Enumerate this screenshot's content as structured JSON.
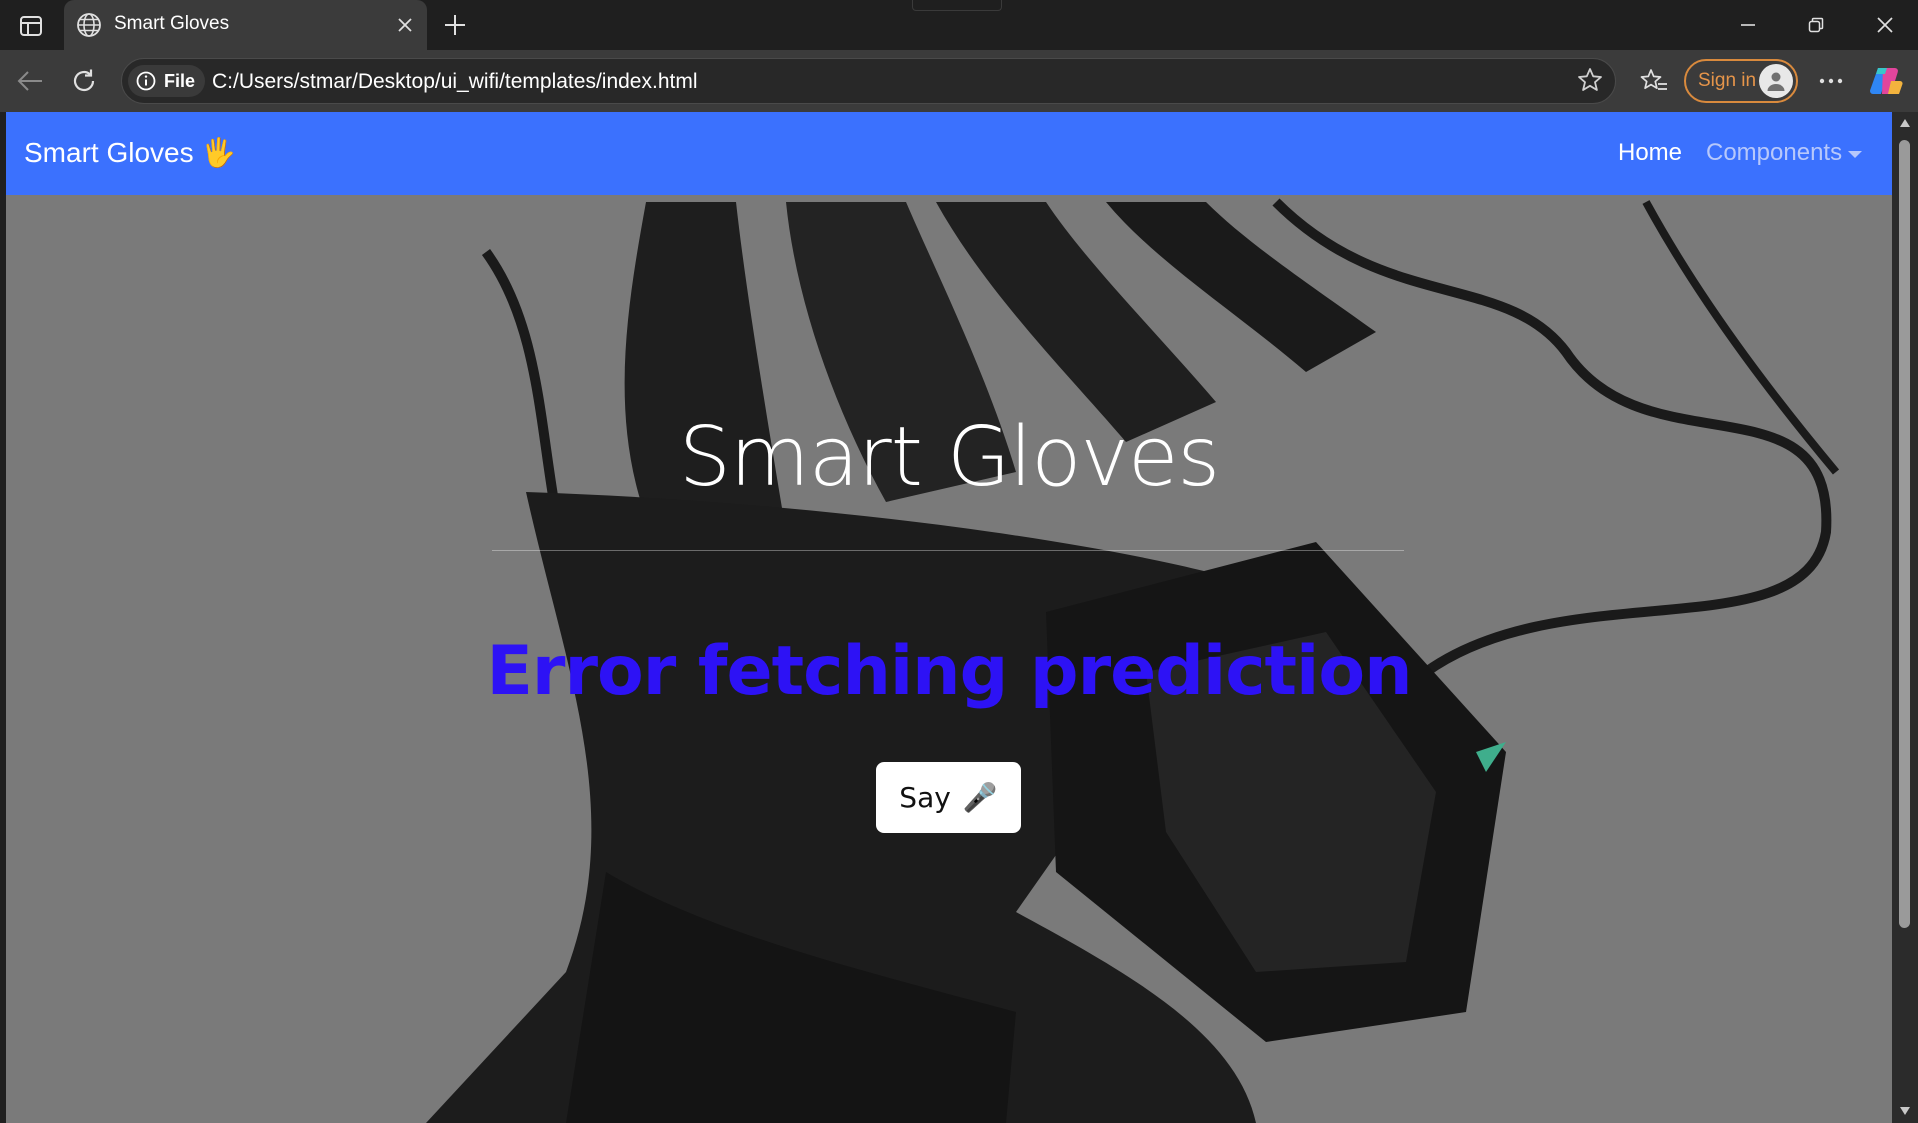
{
  "browser": {
    "tab_title": "Smart Gloves",
    "file_chip": "File",
    "url": "C:/Users/stmar/Desktop/ui_wifi/templates/index.html",
    "sign_in_label": "Sign in"
  },
  "navbar": {
    "brand": "Smart Gloves 🖐",
    "home": "Home",
    "components": "Components"
  },
  "hero": {
    "title": "Smart Gloves",
    "prediction": "Error fetching prediction",
    "say_label": "Say",
    "say_icon": "🎤"
  },
  "colors": {
    "navbar": "#3b71fe",
    "prediction_text": "#2d12f5",
    "sign_in_accent": "#d98a3d"
  }
}
